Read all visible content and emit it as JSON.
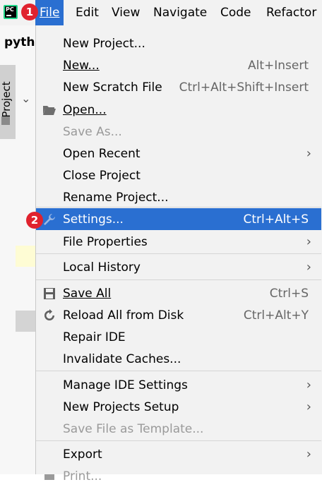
{
  "menubar": {
    "items": [
      "File",
      "Edit",
      "View",
      "Navigate",
      "Code",
      "Refactor"
    ],
    "logo_text": "PC"
  },
  "ide": {
    "project_name": "pytho",
    "tool_tab": "Project"
  },
  "badges": {
    "one": "1",
    "two": "2"
  },
  "menu": {
    "new_project": "New Project...",
    "new": "New...",
    "new_shortcut": "Alt+Insert",
    "new_scratch": "New Scratch File",
    "new_scratch_shortcut": "Ctrl+Alt+Shift+Insert",
    "open": "Open...",
    "save_as": "Save As...",
    "open_recent": "Open Recent",
    "close_project": "Close Project",
    "rename_project": "Rename Project...",
    "settings": "Settings...",
    "settings_shortcut": "Ctrl+Alt+S",
    "file_properties": "File Properties",
    "local_history": "Local History",
    "save_all": "Save All",
    "save_all_shortcut": "Ctrl+S",
    "reload": "Reload All from Disk",
    "reload_shortcut": "Ctrl+Alt+Y",
    "repair_ide": "Repair IDE",
    "invalidate_caches": "Invalidate Caches...",
    "manage_ide_settings": "Manage IDE Settings",
    "new_projects_setup": "New Projects Setup",
    "save_as_template": "Save File as Template...",
    "export": "Export",
    "print": "Print..."
  },
  "colors": {
    "accent": "#2a6fd1",
    "badge": "#e0222e",
    "menu_bg": "#f2f2f2"
  }
}
